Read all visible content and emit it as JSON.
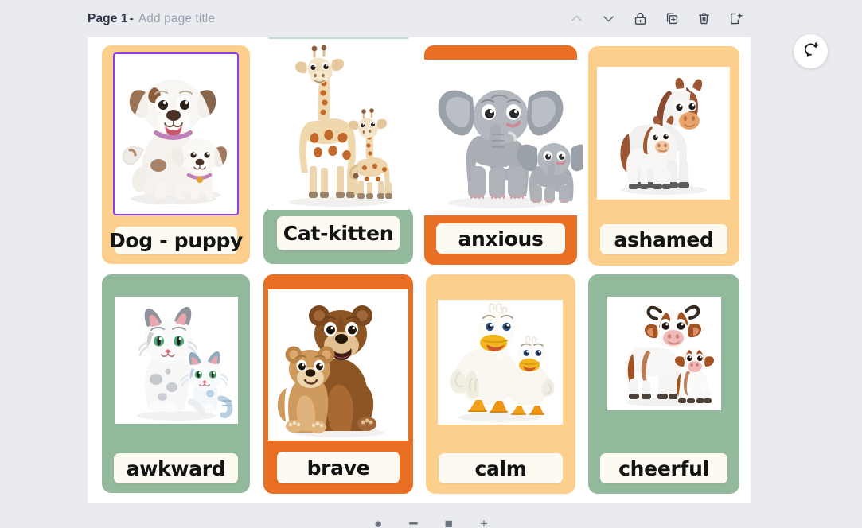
{
  "header": {
    "page_label": "Page 1",
    "separator": "-",
    "title_placeholder": "Add page title",
    "tools": [
      {
        "name": "move-up",
        "icon": "chevron-up-icon",
        "label": "Move page up",
        "disabled": true
      },
      {
        "name": "move-down",
        "icon": "chevron-down-icon",
        "label": "Move page down",
        "disabled": false
      },
      {
        "name": "lock-page",
        "icon": "lock-icon",
        "label": "Lock page",
        "disabled": false
      },
      {
        "name": "duplicate-page",
        "icon": "duplicate-icon",
        "label": "Duplicate page",
        "disabled": false
      },
      {
        "name": "delete-page",
        "icon": "trash-icon",
        "label": "Delete page",
        "disabled": false
      },
      {
        "name": "add-page",
        "icon": "add-page-icon",
        "label": "Add page",
        "disabled": false
      }
    ]
  },
  "comment_button": {
    "icon": "add-comment-icon",
    "label": "Add comment"
  },
  "colors": {
    "background": "#e9ebef",
    "canvas": "#ffffff",
    "peach": "#fcd08c",
    "orange": "#e96f25",
    "green": "#93b99c",
    "label_bg": "#fdfaf2",
    "selection": "#8b3fee",
    "text": "#131313"
  },
  "cards": [
    {
      "id": 1,
      "label": "Dog - puppy",
      "color": "peach",
      "image": "dog-and-puppy-illustration",
      "selected": true
    },
    {
      "id": 2,
      "label": "Cat-kitten",
      "color": "green",
      "image": "giraffe-and-calf-illustration",
      "selected": false
    },
    {
      "id": 3,
      "label": "anxious",
      "color": "orange",
      "image": "elephant-and-calf-illustration",
      "selected": false
    },
    {
      "id": 4,
      "label": "ashamed",
      "color": "peach",
      "image": "horse-and-foal-illustration",
      "selected": false
    },
    {
      "id": 5,
      "label": "awkward",
      "color": "green",
      "image": "cat-and-kitten-illustration",
      "selected": false
    },
    {
      "id": 6,
      "label": "brave",
      "color": "orange",
      "image": "bear-and-cub-illustration",
      "selected": false
    },
    {
      "id": 7,
      "label": "calm",
      "color": "peach",
      "image": "duck-and-duckling-illustration",
      "selected": false
    },
    {
      "id": 8,
      "label": "cheerful",
      "color": "green",
      "image": "cow-and-calf-illustration",
      "selected": false
    }
  ]
}
